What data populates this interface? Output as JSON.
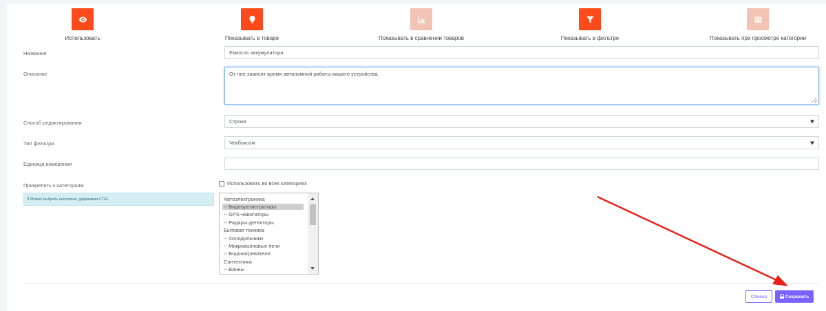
{
  "toggles": [
    {
      "label": "Использовать",
      "icon": "eye-icon",
      "active": true
    },
    {
      "label": "Показывать в товаре",
      "icon": "lightbulb-icon",
      "active": true
    },
    {
      "label": "Показывать в сравнении товаров",
      "icon": "chart-icon",
      "active": false
    },
    {
      "label": "Показывать в фильтре",
      "icon": "filter-icon",
      "active": true
    },
    {
      "label": "Показывать при просмотре категории",
      "icon": "grid-icon",
      "active": false
    }
  ],
  "form": {
    "name_label": "Название",
    "name_value": "Емкость аккумулятора",
    "description_label": "Описание",
    "description_value": "От нее зависит время автономной работы вашего устройства.",
    "edit_mode_label": "Способ редактирования",
    "edit_mode_value": "Строка",
    "filter_type_label": "Тип фильтра",
    "filter_type_value": "Чекбоксом",
    "unit_label": "Единица измерения",
    "unit_value": "",
    "categories_label": "Прикрепить к категориям",
    "categories_hint": "Можно выбрать несколько, удерживая CTRL.",
    "all_categories_label": "Использовать во всех категориях",
    "categories": [
      {
        "label": "Автоэлектроника",
        "selected": false
      },
      {
        "label": "-- Видеорегистраторы",
        "selected": true
      },
      {
        "label": "-- GPS-навигаторы",
        "selected": false
      },
      {
        "label": "-- Радары-детекторы",
        "selected": false
      },
      {
        "label": "Бытовая техника",
        "selected": false
      },
      {
        "label": "-- Холодильники",
        "selected": false
      },
      {
        "label": "-- Микроволновые печи",
        "selected": false
      },
      {
        "label": "-- Водонагреватели",
        "selected": false
      },
      {
        "label": "Сантехника",
        "selected": false
      },
      {
        "label": "-- Ванны",
        "selected": false
      }
    ]
  },
  "actions": {
    "cancel_label": "Отмена",
    "save_label": "Сохранить"
  },
  "colors": {
    "accent_active": "#fc4a1a",
    "accent_inactive": "#f3c4b6",
    "button_primary": "#7b61ff",
    "annotation_arrow": "#e8221b"
  }
}
